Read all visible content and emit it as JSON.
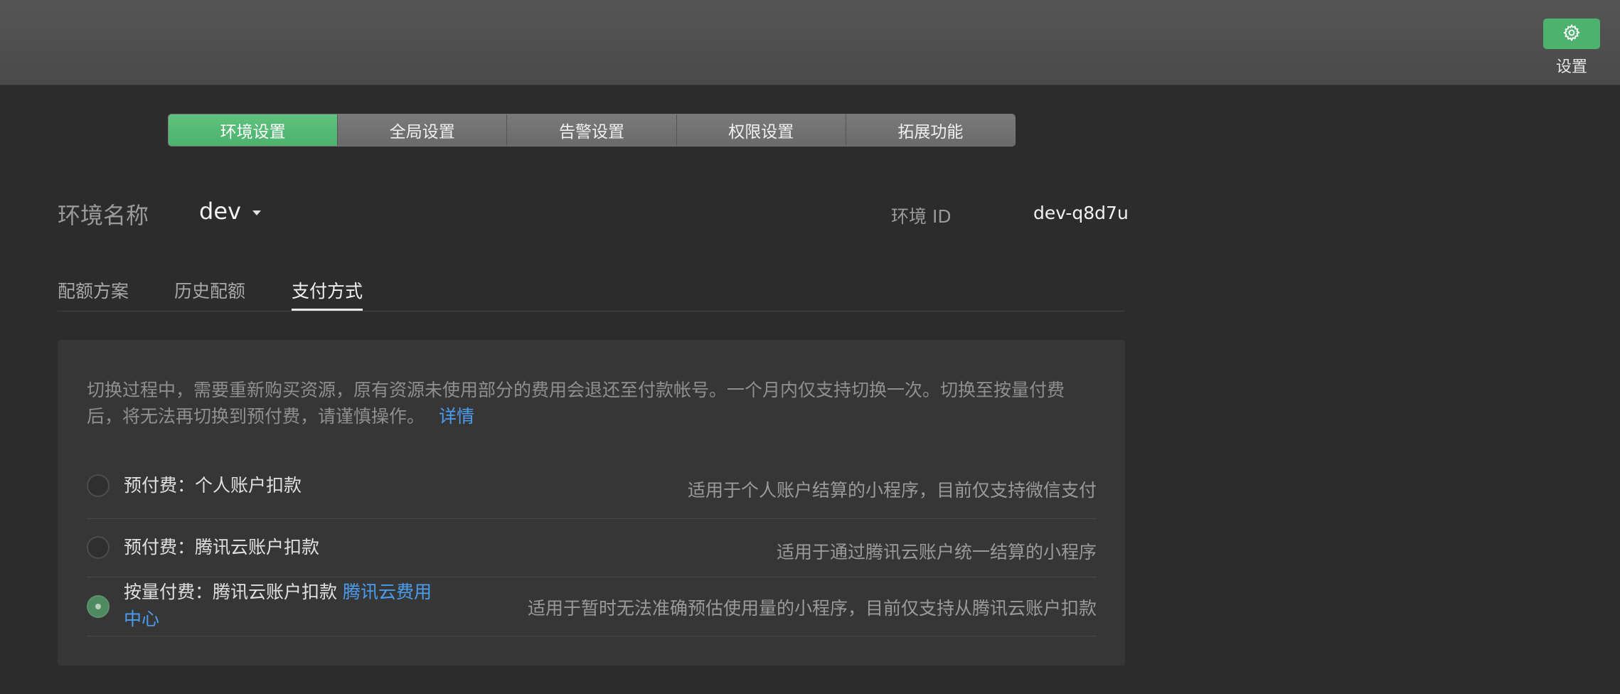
{
  "header": {
    "settings_label": "设置",
    "settings_icon": "gear-icon",
    "accent_color": "#4cb26d"
  },
  "top_tabs": [
    {
      "label": "环境设置",
      "active": true
    },
    {
      "label": "全局设置",
      "active": false
    },
    {
      "label": "告警设置",
      "active": false
    },
    {
      "label": "权限设置",
      "active": false
    },
    {
      "label": "拓展功能",
      "active": false
    }
  ],
  "environment": {
    "name_label": "环境名称",
    "name_value": "dev",
    "id_label": "环境 ID",
    "id_value": "dev-q8d7u"
  },
  "sub_tabs": [
    {
      "label": "配额方案",
      "active": false
    },
    {
      "label": "历史配额",
      "active": false
    },
    {
      "label": "支付方式",
      "active": true
    }
  ],
  "payment": {
    "notice": "切换过程中，需要重新购买资源，原有资源未使用部分的费用会退还至付款帐号。一个月内仅支持切换一次。切换至按量付费后，将无法再切换到预付费，请谨慎操作。",
    "notice_link": "详情",
    "options": [
      {
        "title": "预付费：个人账户扣款",
        "link": "",
        "desc": "适用于个人账户结算的小程序，目前仅支持微信支付",
        "checked": false
      },
      {
        "title": "预付费：腾讯云账户扣款",
        "link": "",
        "desc": "适用于通过腾讯云账户统一结算的小程序",
        "checked": false
      },
      {
        "title": "按量付费：腾讯云账户扣款 ",
        "link": "腾讯云费用中心",
        "desc": "适用于暂时无法准确预估使用量的小程序，目前仅支持从腾讯云账户扣款",
        "checked": true
      }
    ]
  }
}
